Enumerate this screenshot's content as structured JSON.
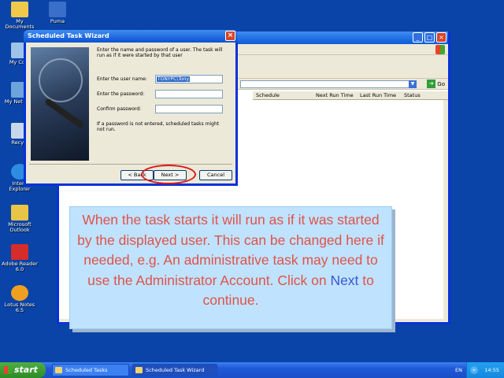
{
  "desktop": {
    "icons": [
      {
        "label": "My Documents",
        "icon": "folder-icon",
        "color": "#f1c84a"
      },
      {
        "label": "Puma",
        "icon": "puma-icon",
        "color": "#3a6fc9"
      },
      {
        "label": "My Com",
        "icon": "computer-icon",
        "color": "#9ec3e8"
      },
      {
        "label": "My Net Plac",
        "icon": "network-icon",
        "color": "#6da4dc"
      },
      {
        "label": "Recycl",
        "icon": "recycle-bin-icon",
        "color": "#c8d8ec"
      },
      {
        "label": "Intern Explorer",
        "icon": "ie-icon",
        "color": "#2e8de0"
      },
      {
        "label": "Microsoft Outlook",
        "icon": "outlook-icon",
        "color": "#e8c547"
      },
      {
        "label": "Adobe Reader 6.0",
        "icon": "adobe-reader-icon",
        "color": "#d62c2c"
      },
      {
        "label": "Lotus Notes 6.5",
        "icon": "lotus-notes-icon",
        "color": "#f0a020"
      }
    ]
  },
  "explorer": {
    "columns": [
      "Schedule",
      "Next Run Time",
      "Last Run Time",
      "Status"
    ],
    "go_label": "Go"
  },
  "wizard": {
    "title": "Scheduled Task Wizard",
    "intro": "Enter the name and password of a user.  The task will run as if it were started by that user",
    "user_label": "Enter the user name:",
    "user_value": "TONYPC\\Tony",
    "password_label": "Enter the password:",
    "confirm_label": "Confirm password:",
    "note": "If a password is not entered, scheduled tasks might not run.",
    "back_label": "< Back",
    "next_label": "Next >",
    "cancel_label": "Cancel"
  },
  "callout": {
    "text_before": "When the task starts it will run as if it was started by the displayed user. This can be changed here if needed, e.g. An administrative task may need to use the Administrator Account. Click on ",
    "highlight": "Next",
    "text_after": " to continue."
  },
  "taskbar": {
    "start_label": "start",
    "tasks": [
      "Scheduled Tasks",
      "Scheduled Task Wizard"
    ],
    "lang": "EN",
    "clock": "14:55"
  }
}
